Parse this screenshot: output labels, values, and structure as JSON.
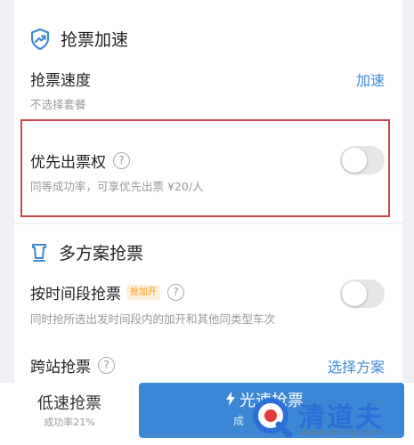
{
  "section1": {
    "title": "抢票加速",
    "speed": {
      "label": "抢票速度",
      "sub": "不选择套餐",
      "action": "加速"
    },
    "priority": {
      "label": "优先出票权",
      "help": "?",
      "desc": "同等成功率，可享优先出票 ¥20/人",
      "enabled": false
    }
  },
  "section2": {
    "title": "多方案抢票",
    "timeslot": {
      "label": "按时间段抢票",
      "badge": "抢加开",
      "help": "?",
      "desc": "同时抢所选出发时间段内的加开和其他同类型车次",
      "enabled": false
    },
    "cross": {
      "label": "跨站抢票",
      "help": "?",
      "action": "选择方案"
    }
  },
  "bottom": {
    "slow": {
      "label": "低速抢票",
      "sub": "成功率21%"
    },
    "fast": {
      "label": "光速抢票",
      "sub": "成"
    }
  },
  "watermark": {
    "text": "清道夫",
    "url": "WWW.QDFUJI.COM"
  },
  "colors": {
    "accent": "#3b87d6",
    "link": "#3d8bd8",
    "highlight": "#c84848",
    "badge": "#f29a1d"
  },
  "icons": {
    "section1": "shield-speed-icon",
    "section2": "seat-icon",
    "help": "help-circle-icon",
    "fast": "bolt-icon"
  }
}
